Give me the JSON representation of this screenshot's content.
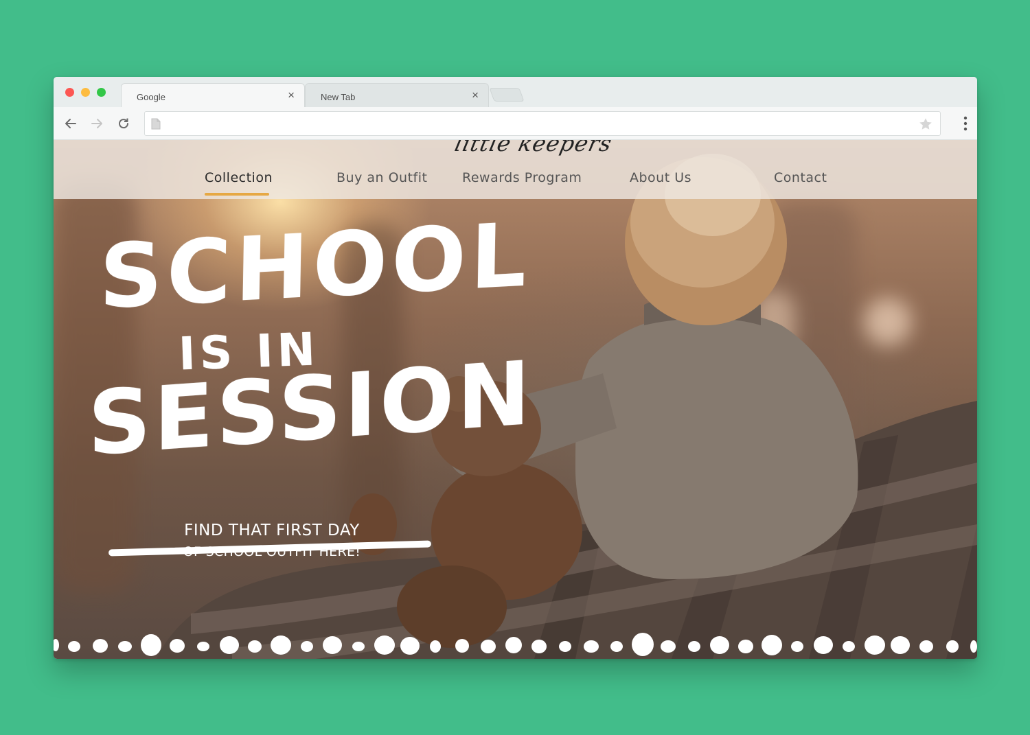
{
  "browser": {
    "tabs": [
      {
        "title": "Google",
        "close_glyph": "×"
      },
      {
        "title": "New Tab",
        "close_glyph": "×"
      }
    ],
    "url": "",
    "icons": {
      "back": "arrow-left-icon",
      "forward": "arrow-right-icon",
      "reload": "reload-icon",
      "page": "page-icon",
      "bookmark": "star-icon",
      "menu": "kebab-menu-icon"
    }
  },
  "site": {
    "logo": "little keepers",
    "nav": [
      {
        "label": "Collection",
        "active": true
      },
      {
        "label": "Buy an Outfit",
        "active": false
      },
      {
        "label": "Rewards Program",
        "active": false
      },
      {
        "label": "About Us",
        "active": false
      },
      {
        "label": "Contact",
        "active": false
      }
    ],
    "hero": {
      "line1": "SCHOOL",
      "line2": "IS IN",
      "line3": "SESSION",
      "subtitle_1": "FIND THAT FIRST DAY",
      "subtitle_2": "OF SCHOOL OUTFIT HERE!"
    }
  },
  "colors": {
    "background": "#42bd8a",
    "nav_active_underline": "#e6a843",
    "traffic_red": "#fc5753",
    "traffic_yellow": "#fdbc40",
    "traffic_green": "#33c748"
  }
}
